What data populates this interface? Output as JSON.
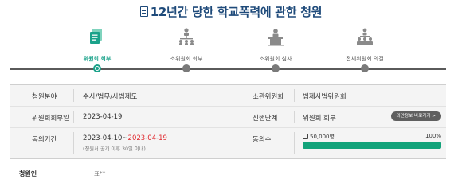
{
  "page": {
    "title": "12년간 당한 학교폭력에 관한 청원"
  },
  "steps": [
    {
      "label": "위원회 회부",
      "icon": "documents-stack-icon",
      "active": true
    },
    {
      "label": "소위원회 회부",
      "icon": "org-chart-icon",
      "active": false
    },
    {
      "label": "소위원회 심사",
      "icon": "podium-meeting-icon",
      "active": false
    },
    {
      "label": "전체위원회 의결",
      "icon": "assembly-vote-icon",
      "active": false
    }
  ],
  "info": {
    "field_label": "청원분야",
    "field_value": "수사/법무/사법제도",
    "committee_label": "소관위원회",
    "committee_value": "법제사법위원회",
    "referral_date_label": "위원회회부일",
    "referral_date_value": "2023-04-19",
    "status_label": "진행단계",
    "status_value": "위원회 회부",
    "status_button": "의안정보 바로가기 >",
    "period_label": "동의기간",
    "period_start": "2023-04-10",
    "period_sep": "~",
    "period_end": "2023-04-19",
    "period_note": "(청원서 공개 이후 30일 이내)",
    "agree_label": "동의수",
    "agree_count": "50,000명",
    "agree_percent": "100%",
    "agree_progress": 1.0
  },
  "petitioner": {
    "label": "청원인",
    "value": "표**"
  },
  "colors": {
    "title": "#1e4a7a",
    "active_step": "#1aa28a",
    "progress_fill": "#12a37a",
    "period_end": "#e0262b"
  }
}
